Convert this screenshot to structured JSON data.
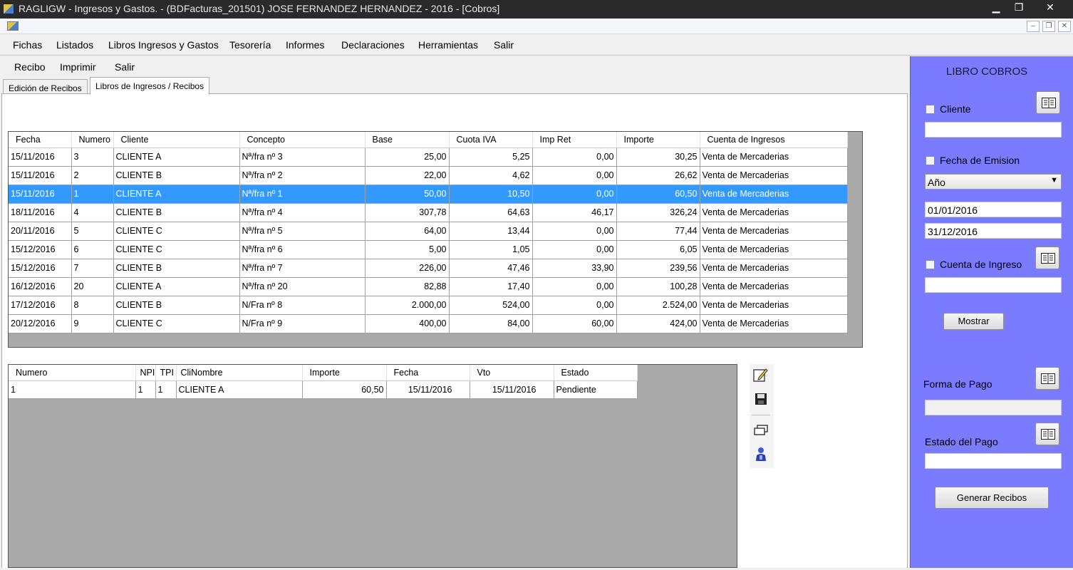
{
  "window": {
    "title": "RAGLIGW - Ingresos y Gastos. - (BDFacturas_201501)   JOSE FERNANDEZ HERNANDEZ - 2016 - [Cobros]",
    "min": "▁",
    "max": "❐",
    "close": "✕"
  },
  "mdi": {
    "min": "–",
    "restore": "❐",
    "close": "✕"
  },
  "menu": {
    "items": [
      "Fichas",
      "Listados",
      "Libros Ingresos y Gastos",
      "Tesorería",
      "Informes",
      "Declaraciones",
      "Herramientas",
      "Salir"
    ]
  },
  "submenu": {
    "items": [
      "Recibo",
      "Imprimir",
      "Salir"
    ]
  },
  "tabs": [
    {
      "label": "Edición de Recibos",
      "active": false
    },
    {
      "label": "Libros de Ingresos / Recibos",
      "active": true
    }
  ],
  "grid1": {
    "headers": [
      "Fecha",
      "Numero",
      "Cliente",
      "Concepto",
      "Base",
      "Cuota IVA",
      "Imp Ret",
      "Importe",
      "Cuenta de Ingresos"
    ],
    "rows": [
      [
        "15/11/2016",
        "3",
        "CLIENTE A",
        "Nª/fra nº 3",
        "25,00",
        "5,25",
        "0,00",
        "30,25",
        "Venta de Mercaderias"
      ],
      [
        "15/11/2016",
        "2",
        "CLIENTE B",
        "Nª/fra nº 2",
        "22,00",
        "4,62",
        "0,00",
        "26,62",
        "Venta de Mercaderias"
      ],
      [
        "15/11/2016",
        "1",
        "CLIENTE A",
        "Nª/fra nº 1",
        "50,00",
        "10,50",
        "0,00",
        "60,50",
        "Venta de Mercaderias"
      ],
      [
        "18/11/2016",
        "4",
        "CLIENTE B",
        "Nª/fra nº 4",
        "307,78",
        "64,63",
        "46,17",
        "326,24",
        "Venta de Mercaderias"
      ],
      [
        "20/11/2016",
        "5",
        "CLIENTE C",
        "Nª/fra nº 5",
        "64,00",
        "13,44",
        "0,00",
        "77,44",
        "Venta de Mercaderias"
      ],
      [
        "15/12/2016",
        "6",
        "CLIENTE C",
        "Nª/fra nº 6",
        "5,00",
        "1,05",
        "0,00",
        "6,05",
        "Venta de Mercaderias"
      ],
      [
        "15/12/2016",
        "7",
        "CLIENTE B",
        "Nª/fra nº 7",
        "226,00",
        "47,46",
        "33,90",
        "239,56",
        "Venta de Mercaderias"
      ],
      [
        "16/12/2016",
        "20",
        "CLIENTE A",
        "Nª/fra nº 20",
        "82,88",
        "17,40",
        "0,00",
        "100,28",
        "Venta de Mercaderias"
      ],
      [
        "17/12/2016",
        "8",
        "CLIENTE B",
        "N/Fra nº 8",
        "2.000,00",
        "524,00",
        "0,00",
        "2.524,00",
        "Venta de Mercaderias"
      ],
      [
        "20/12/2016",
        "9",
        "CLIENTE C",
        "N/Fra nº 9",
        "400,00",
        "84,00",
        "60,00",
        "424,00",
        "Venta de Mercaderias"
      ]
    ],
    "selected_row": 2
  },
  "grid2": {
    "headers": [
      "Numero",
      "NPI",
      "TPI",
      "CliNombre",
      "Importe",
      "Fecha",
      "Vto",
      "Estado"
    ],
    "rows": [
      [
        "1",
        "1",
        "1",
        "CLIENTE A",
        "60,50",
        "15/11/2016",
        "15/11/2016",
        "Pendiente"
      ]
    ]
  },
  "side_icons": [
    "edit-icon",
    "save-icon",
    "windows-icon",
    "user-icon"
  ],
  "panel": {
    "title": "LIBRO COBROS",
    "cliente_label": "Cliente",
    "cliente_value": "",
    "fecha_label": "Fecha de Emision",
    "periodo_selected": "Año",
    "fecha_desde": "01/01/2016",
    "fecha_hasta": "31/12/2016",
    "cuenta_label": "Cuenta de Ingreso",
    "cuenta_value": "",
    "mostrar": "Mostrar",
    "forma_label": "Forma de Pago",
    "forma_value": "",
    "estado_label": "Estado del Pago",
    "estado_value": "",
    "generar": "Generar Recibos"
  },
  "colors": {
    "panel": "#7b7bff",
    "selection": "#3399ff",
    "grid_bg": "#a9a9a9"
  }
}
